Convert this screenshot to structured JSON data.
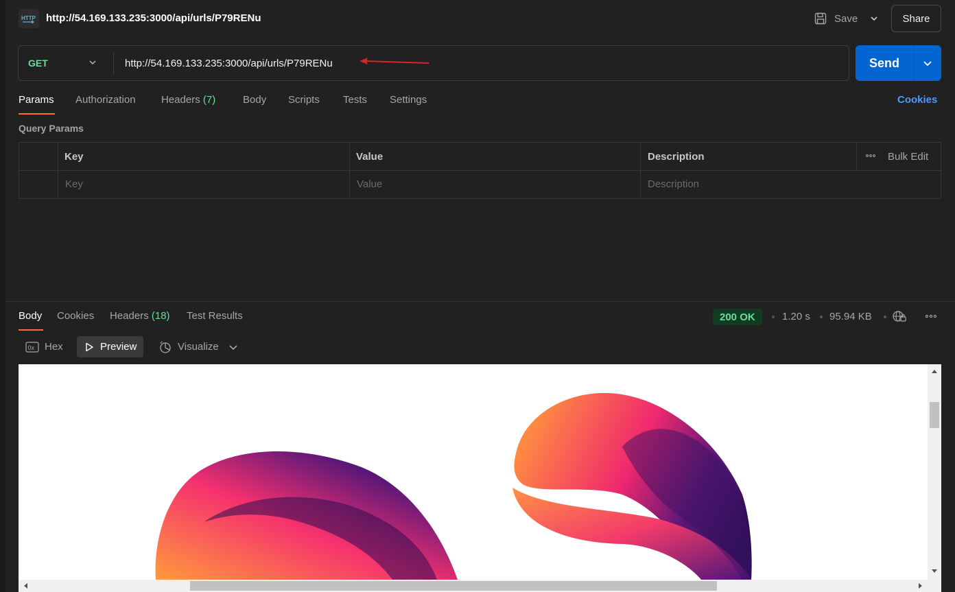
{
  "request": {
    "title": "http://54.169.133.235:3000/api/urls/P79RENu",
    "save_label": "Save",
    "share_label": "Share",
    "method": "GET",
    "url": "http://54.169.133.235:3000/api/urls/P79RENu",
    "send_label": "Send"
  },
  "request_tabs": {
    "params": "Params",
    "authorization": "Authorization",
    "headers": "Headers",
    "headers_count": "(7)",
    "body": "Body",
    "scripts": "Scripts",
    "tests": "Tests",
    "settings": "Settings",
    "cookies": "Cookies"
  },
  "query_params": {
    "label": "Query Params",
    "columns": [
      "Key",
      "Value",
      "Description"
    ],
    "bulk_edit": "Bulk Edit",
    "placeholders": [
      "Key",
      "Value",
      "Description"
    ]
  },
  "response": {
    "tabs": {
      "body": "Body",
      "cookies": "Cookies",
      "headers": "Headers",
      "headers_count": "(18)",
      "test_results": "Test Results"
    },
    "status": "200 OK",
    "time": "1.20 s",
    "size": "95.94 KB",
    "view_modes": [
      "Hex",
      "Preview",
      "Visualize"
    ],
    "active_view": "Preview"
  },
  "colors": {
    "accent_send": "#0265d2",
    "method_get": "#6bdd9a",
    "tab_underline": "#ff6c37",
    "link": "#4c9aff",
    "arrow_annotation": "#d62828"
  }
}
